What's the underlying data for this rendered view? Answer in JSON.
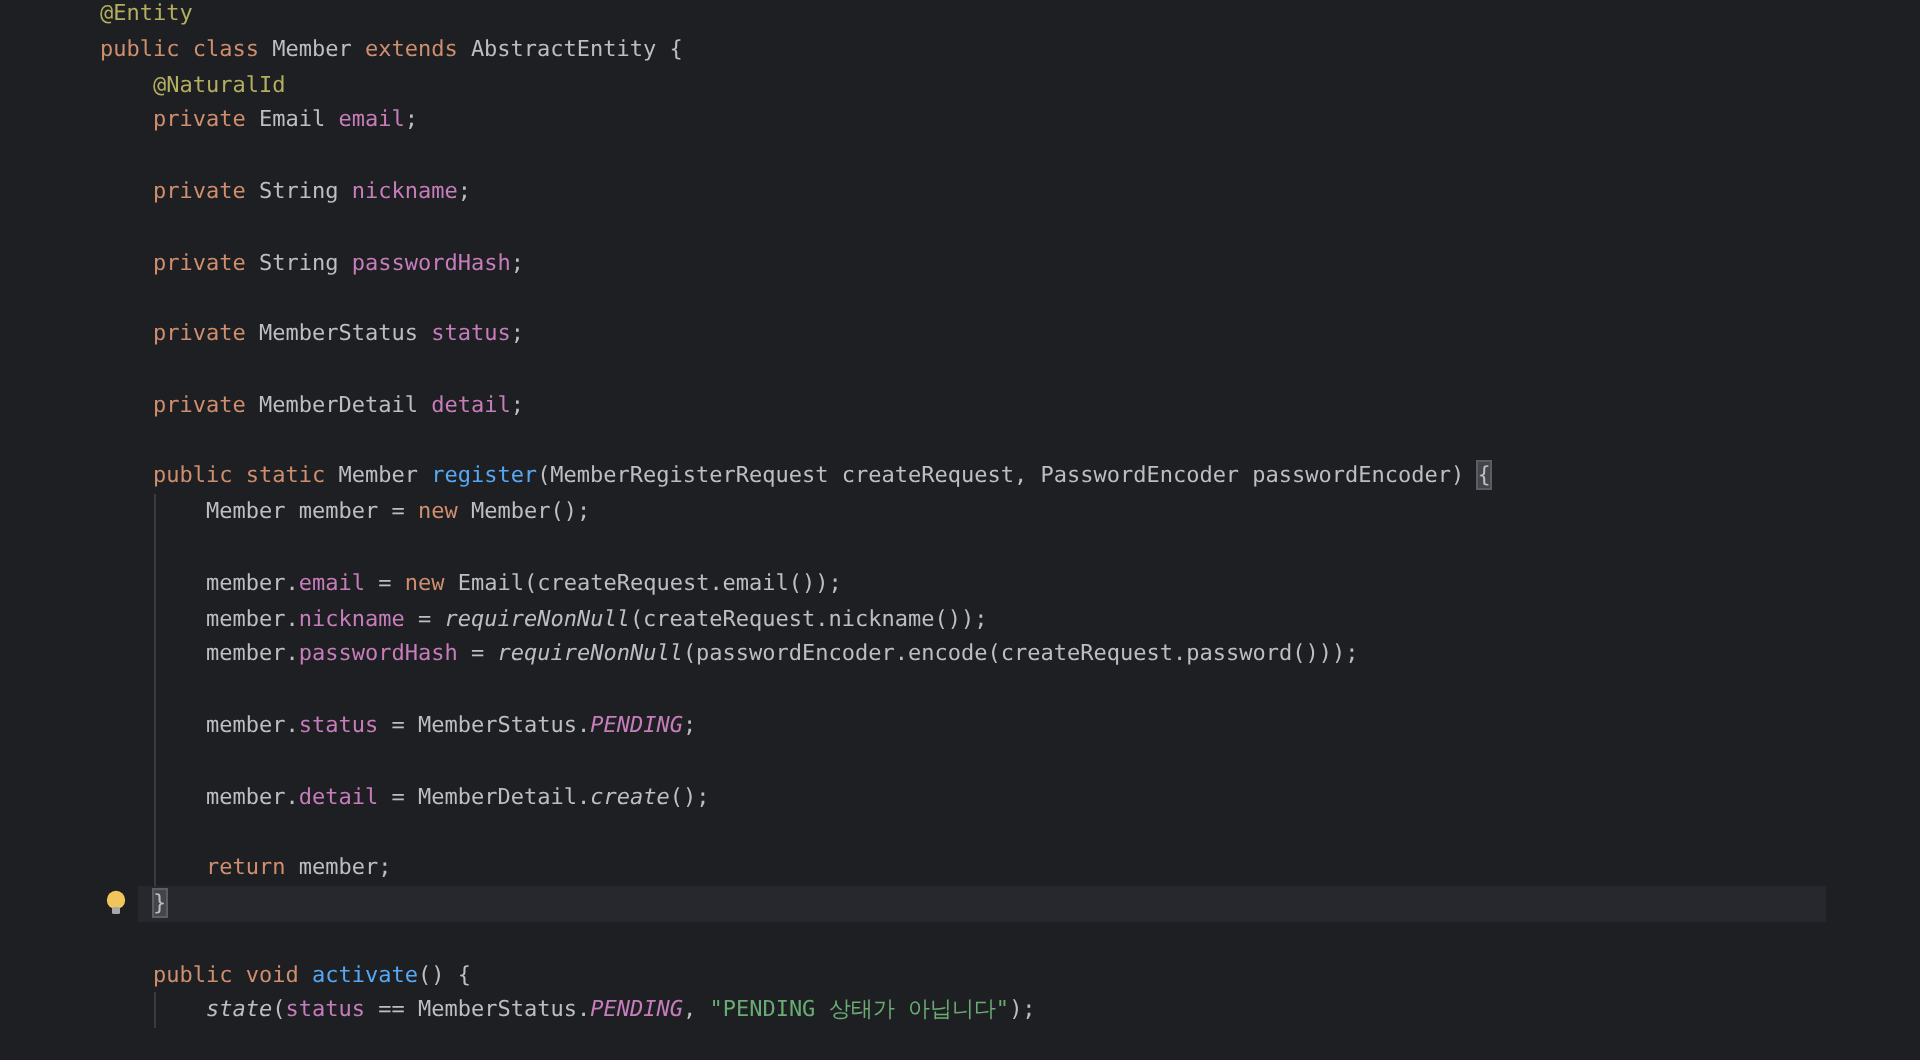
{
  "editor": {
    "lines": [
      {
        "kind": "code",
        "tokens": [
          {
            "kind": "annotation",
            "text": "@Entity"
          }
        ]
      },
      {
        "kind": "code",
        "tokens": [
          {
            "kind": "keyword",
            "text": "public class "
          },
          {
            "kind": "plain",
            "text": "Member "
          },
          {
            "kind": "keyword",
            "text": "extends "
          },
          {
            "kind": "plain",
            "text": "AbstractEntity {"
          }
        ],
        "children": [
          {
            "kind": "code",
            "tokens": [
              {
                "kind": "annotation",
                "text": "@NaturalId"
              }
            ]
          },
          {
            "kind": "code",
            "tokens": [
              {
                "kind": "keyword",
                "text": "private "
              },
              {
                "kind": "plain",
                "text": "Email "
              },
              {
                "kind": "field",
                "text": "email"
              },
              {
                "kind": "plain",
                "text": ";"
              }
            ]
          },
          {
            "kind": "blank"
          },
          {
            "kind": "code",
            "tokens": [
              {
                "kind": "keyword",
                "text": "private "
              },
              {
                "kind": "plain",
                "text": "String "
              },
              {
                "kind": "field",
                "text": "nickname"
              },
              {
                "kind": "plain",
                "text": ";"
              }
            ]
          },
          {
            "kind": "blank"
          },
          {
            "kind": "code",
            "tokens": [
              {
                "kind": "keyword",
                "text": "private "
              },
              {
                "kind": "plain",
                "text": "String "
              },
              {
                "kind": "field",
                "text": "passwordHash"
              },
              {
                "kind": "plain",
                "text": ";"
              }
            ]
          },
          {
            "kind": "blank"
          },
          {
            "kind": "code",
            "tokens": [
              {
                "kind": "keyword",
                "text": "private "
              },
              {
                "kind": "plain",
                "text": "MemberStatus "
              },
              {
                "kind": "field",
                "text": "status"
              },
              {
                "kind": "plain",
                "text": ";"
              }
            ]
          },
          {
            "kind": "blank"
          },
          {
            "kind": "code",
            "tokens": [
              {
                "kind": "keyword",
                "text": "private "
              },
              {
                "kind": "plain",
                "text": "MemberDetail "
              },
              {
                "kind": "field",
                "text": "detail"
              },
              {
                "kind": "plain",
                "text": ";"
              }
            ]
          },
          {
            "kind": "blank"
          },
          {
            "kind": "code",
            "tokens": [
              {
                "kind": "keyword",
                "text": "public static "
              },
              {
                "kind": "plain",
                "text": "Member "
              },
              {
                "kind": "declaration",
                "text": "register"
              },
              {
                "kind": "plain",
                "text": "(MemberRegisterRequest createRequest, PasswordEncoder passwordEncoder) "
              },
              {
                "kind": "brace_match",
                "text": "{"
              }
            ],
            "children": [
              {
                "kind": "code",
                "tokens": [
                  {
                    "kind": "plain",
                    "text": "Member member = "
                  },
                  {
                    "kind": "keyword",
                    "text": "new "
                  },
                  {
                    "kind": "plain",
                    "text": "Member();"
                  }
                ]
              },
              {
                "kind": "blank"
              },
              {
                "kind": "code",
                "tokens": [
                  {
                    "kind": "plain",
                    "text": "member."
                  },
                  {
                    "kind": "field",
                    "text": "email"
                  },
                  {
                    "kind": "plain",
                    "text": " = "
                  },
                  {
                    "kind": "keyword",
                    "text": "new "
                  },
                  {
                    "kind": "plain",
                    "text": "Email(createRequest.email());"
                  }
                ]
              },
              {
                "kind": "code",
                "tokens": [
                  {
                    "kind": "plain",
                    "text": "member."
                  },
                  {
                    "kind": "field",
                    "text": "nickname"
                  },
                  {
                    "kind": "plain",
                    "text": " = "
                  },
                  {
                    "kind": "static_call",
                    "text": "requireNonNull"
                  },
                  {
                    "kind": "plain",
                    "text": "(createRequest.nickname());"
                  }
                ]
              },
              {
                "kind": "code",
                "tokens": [
                  {
                    "kind": "plain",
                    "text": "member."
                  },
                  {
                    "kind": "field",
                    "text": "passwordHash"
                  },
                  {
                    "kind": "plain",
                    "text": " = "
                  },
                  {
                    "kind": "static_call",
                    "text": "requireNonNull"
                  },
                  {
                    "kind": "plain",
                    "text": "(passwordEncoder.encode(createRequest.password()));"
                  }
                ]
              },
              {
                "kind": "blank"
              },
              {
                "kind": "code",
                "tokens": [
                  {
                    "kind": "plain",
                    "text": "member."
                  },
                  {
                    "kind": "field",
                    "text": "status"
                  },
                  {
                    "kind": "plain",
                    "text": " = MemberStatus."
                  },
                  {
                    "kind": "constant",
                    "text": "PENDING"
                  },
                  {
                    "kind": "plain",
                    "text": ";"
                  }
                ]
              },
              {
                "kind": "blank"
              },
              {
                "kind": "code",
                "tokens": [
                  {
                    "kind": "plain",
                    "text": "member."
                  },
                  {
                    "kind": "field",
                    "text": "detail"
                  },
                  {
                    "kind": "plain",
                    "text": " = MemberDetail."
                  },
                  {
                    "kind": "static_call",
                    "text": "create"
                  },
                  {
                    "kind": "plain",
                    "text": "();"
                  }
                ]
              },
              {
                "kind": "blank"
              },
              {
                "kind": "code",
                "tokens": [
                  {
                    "kind": "keyword",
                    "text": "return "
                  },
                  {
                    "kind": "plain",
                    "text": "member;"
                  }
                ]
              }
            ]
          },
          {
            "kind": "code",
            "current": true,
            "bulb": true,
            "tokens": [
              {
                "kind": "brace_match",
                "text": "}"
              }
            ]
          },
          {
            "kind": "blank"
          },
          {
            "kind": "code",
            "tokens": [
              {
                "kind": "keyword",
                "text": "public void "
              },
              {
                "kind": "declaration",
                "text": "activate"
              },
              {
                "kind": "plain",
                "text": "() {"
              }
            ],
            "children": [
              {
                "kind": "code",
                "tokens": [
                  {
                    "kind": "static_call",
                    "text": "state"
                  },
                  {
                    "kind": "plain",
                    "text": "("
                  },
                  {
                    "kind": "field",
                    "text": "status"
                  },
                  {
                    "kind": "plain",
                    "text": " == MemberStatus."
                  },
                  {
                    "kind": "constant",
                    "text": "PENDING"
                  },
                  {
                    "kind": "plain",
                    "text": ", "
                  },
                  {
                    "kind": "string",
                    "text": "\"PENDING 상태가 아닙니다\""
                  },
                  {
                    "kind": "plain",
                    "text": ");"
                  }
                ]
              }
            ]
          }
        ]
      }
    ]
  }
}
